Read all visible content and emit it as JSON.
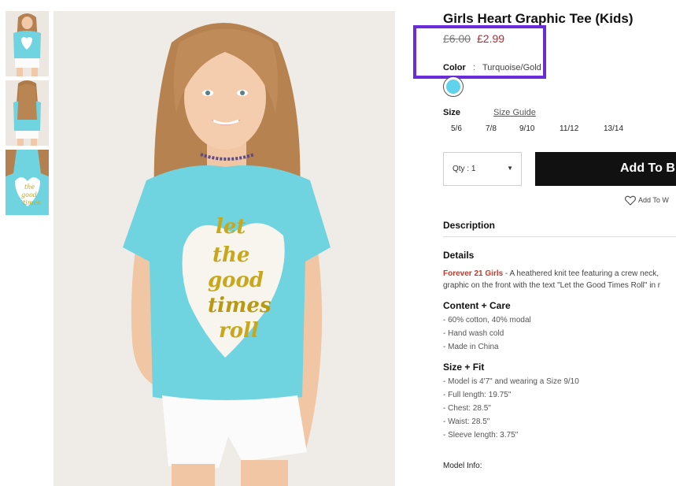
{
  "product": {
    "title": "Girls Heart Graphic Tee (Kids)",
    "price_original": "£6.00",
    "price_sale": "£2.99",
    "color_label": "Color",
    "color_separator": ":",
    "color_value": "Turquoise/Gold",
    "swatch_color": "#5fd3ec",
    "size_label": "Size",
    "size_guide_label": "Size Guide",
    "sizes": [
      "5/6",
      "7/8",
      "9/10",
      "11/12",
      "13/14"
    ],
    "qty_label": "Qty : 1",
    "add_to_bag_label": "Add To B",
    "wishlist_label": "Add To W"
  },
  "description": {
    "header": "Description",
    "details_title": "Details",
    "details_brand": "Forever 21 Girls",
    "details_line1": " - A heathered knit tee featuring a crew neck,",
    "details_line2": "graphic on the front with the text \"Let the Good Times Roll\" in r",
    "care_title": "Content + Care",
    "care_items": [
      "- 60% cotton, 40% modal",
      "- Hand wash cold",
      "- Made in China"
    ],
    "fit_title": "Size + Fit",
    "fit_items": [
      "- Model is 4'7\" and wearing a Size 9/10",
      "- Full length: 19.75\"",
      "- Chest: 28.5\"",
      "- Waist: 28.5\"",
      "- Sleeve length: 3.75\""
    ],
    "model_info": "Model Info:"
  },
  "graphic": {
    "shirt_text_1": "let",
    "shirt_text_2": "the",
    "shirt_text_3": "good",
    "shirt_text_4": "times",
    "shirt_text_5": "roll"
  },
  "colors": {
    "accent_highlight": "#6a2bd8",
    "sale_price": "#c0262c",
    "button_bg": "#111111",
    "shirt": "#6fd3e0",
    "print_gold": "#c8a81a"
  }
}
